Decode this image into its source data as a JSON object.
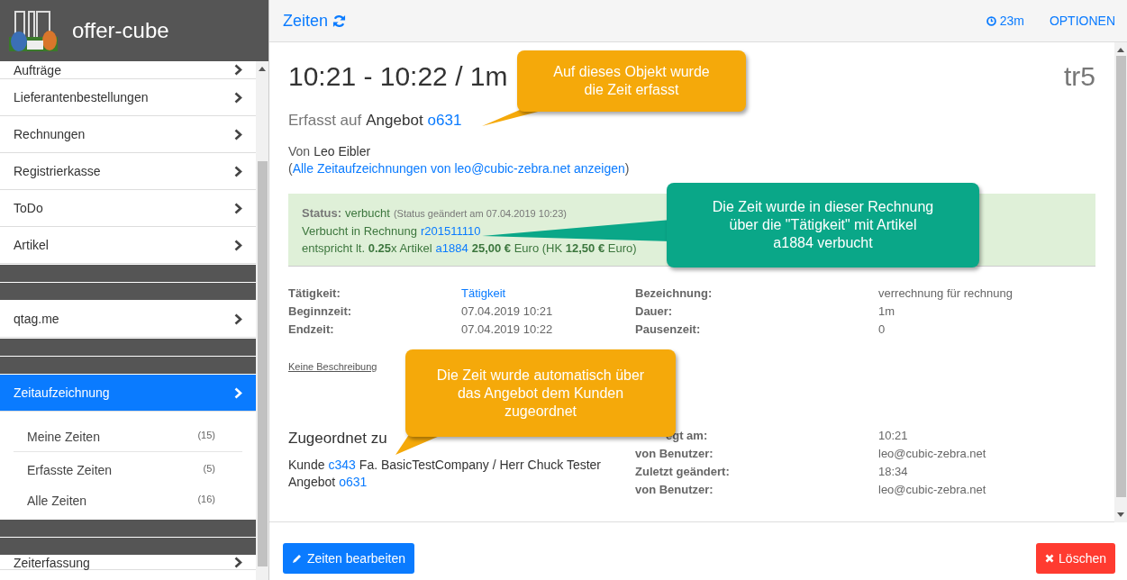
{
  "app": {
    "name": "offer-cube"
  },
  "sidebar": {
    "items": [
      {
        "kind": "link",
        "label": "Aufträge",
        "selected": false
      },
      {
        "kind": "link",
        "label": "Lieferantenbestellungen",
        "selected": false
      },
      {
        "kind": "link",
        "label": "Rechnungen",
        "selected": false
      },
      {
        "kind": "link",
        "label": "Registrierkasse",
        "selected": false
      },
      {
        "kind": "link",
        "label": "ToDo",
        "selected": false
      },
      {
        "kind": "link",
        "label": "Artikel",
        "selected": false
      },
      {
        "kind": "separator"
      },
      {
        "kind": "link",
        "label": "qtag.me",
        "selected": false
      },
      {
        "kind": "separator"
      },
      {
        "kind": "link",
        "label": "Zeitaufzeichnung",
        "selected": true,
        "children": [
          {
            "label": "Meine Zeiten",
            "count": "(15)"
          },
          {
            "label": "Erfasste Zeiten",
            "count": "(5)"
          },
          {
            "label": "Alle Zeiten",
            "count": "(16)"
          }
        ]
      },
      {
        "kind": "separator"
      },
      {
        "kind": "link",
        "label": "Zeiterfassung",
        "selected": false
      }
    ]
  },
  "topbar": {
    "title": "Zeiten",
    "timer": "23m",
    "options": "OPTIONEN"
  },
  "record": {
    "title": "10:21 - 10:22 / 1m",
    "id": "tr5",
    "captured": {
      "prefix": "Erfasst auf",
      "object": "Angebot",
      "link": "o631"
    },
    "author": {
      "prefix": "Von",
      "name": "Leo Eibler"
    },
    "all_open": "(",
    "all_link": "Alle Zeitaufzeichnungen von leo@cubic-zebra.net anzeigen",
    "all_close": ")",
    "status": {
      "label": "Status:",
      "value": "verbucht",
      "changed": "(Status geändert am 07.04.2019 10:23)",
      "booked": "Verbucht in Rechnung",
      "invoice": "r201511110",
      "equiv": "entspricht lt. **0.25**x Artikel",
      "article": "a1884",
      "price": "**25,00 €** Euro (HK **12,50 €** Euro)"
    },
    "fields_left": [
      {
        "label": "Tätigkeit:",
        "value": "Tätigkeit",
        "link": true
      },
      {
        "label": "Beginnzeit:",
        "value": "07.04.2019 10:21",
        "link": false
      },
      {
        "label": "Endzeit:",
        "value": "07.04.2019 10:22",
        "link": false
      }
    ],
    "fields_right": [
      {
        "label": "Bezeichnung:",
        "value": "verrechnung für rechnung"
      },
      {
        "label": "Dauer:",
        "value": "1m"
      },
      {
        "label": "Pausenzeit:",
        "value": "0"
      }
    ],
    "description": "Keine Beschreibung",
    "assigned": {
      "heading": "Zugeordnet zu",
      "customer_prefix": "Kunde",
      "customer_link": "c343",
      "customer_name": "Fa. BasicTestCompany / Herr Chuck Tester",
      "offer_prefix": "Angebot",
      "offer_link": "o631"
    },
    "meta": [
      {
        "label": "egt am:",
        "value": "10:21"
      },
      {
        "label": "von Benutzer:",
        "value": "leo@cubic-zebra.net"
      },
      {
        "label": "Zuletzt geändert:",
        "value": "18:34"
      },
      {
        "label": "von Benutzer:",
        "value": "leo@cubic-zebra.net"
      }
    ]
  },
  "footer": {
    "edit": "Zeiten bearbeiten",
    "delete": "Löschen"
  },
  "callouts": [
    {
      "text": "Auf dieses Objekt wurde die Zeit erfasst",
      "color": "#f5a90a"
    },
    {
      "text": "Die Zeit wurde in dieser Rechnung über die \"Tätigkeit\" mit Artikel a1884 verbucht",
      "color": "#0aa788"
    },
    {
      "text": "Die Zeit wurde automatisch über das Angebot dem Kunden zugeordnet",
      "color": "#f5a90a"
    }
  ]
}
